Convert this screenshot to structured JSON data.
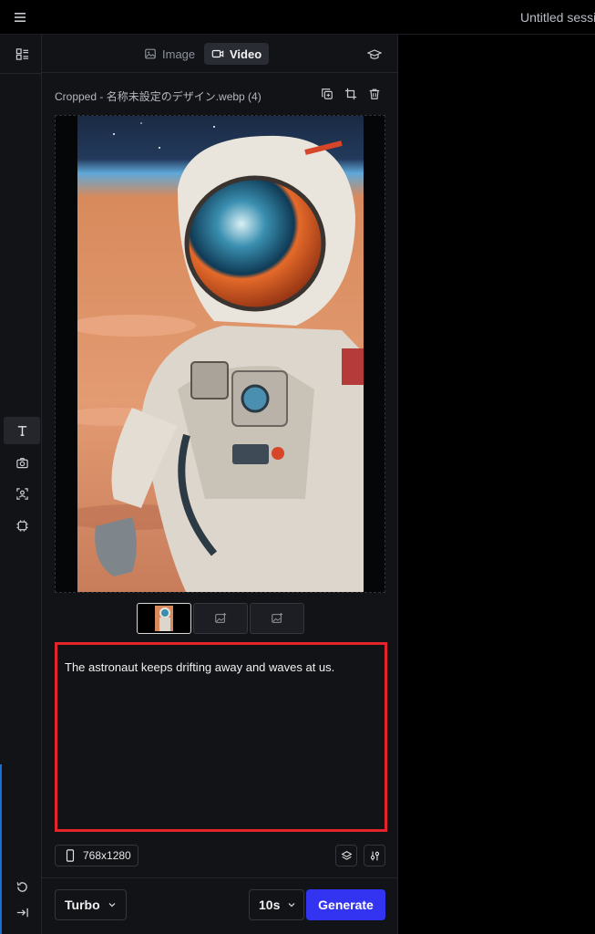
{
  "session": {
    "title": "Untitled session"
  },
  "modes": [
    {
      "label": "Image",
      "icon": "image-icon",
      "active": false
    },
    {
      "label": "Video",
      "icon": "video-camera-icon",
      "active": true
    }
  ],
  "file": {
    "title": "Cropped - 名称未設定のデザイン.webp (4)",
    "tools": [
      "duplicate-icon",
      "crop-icon",
      "trash-icon"
    ]
  },
  "thumbnails": [
    {
      "kind": "image",
      "active": true
    },
    {
      "kind": "placeholder",
      "icon": "add-image-icon",
      "active": false
    },
    {
      "kind": "placeholder",
      "icon": "add-image-icon",
      "active": false
    }
  ],
  "prompt": {
    "value": "The astronaut keeps drifting away and waves at us."
  },
  "resolution": {
    "label": "768x1280",
    "icon": "phone-portrait-icon"
  },
  "footer": {
    "model": "Turbo",
    "duration": "10s",
    "generate_label": "Generate"
  },
  "rail": [
    "text-icon",
    "camera-icon",
    "face-scan-icon",
    "frame-icon",
    "undo-icon",
    "collapse-icon"
  ],
  "colors": {
    "accent": "#3333f2",
    "highlight": "#e3242b",
    "panel": "#121317"
  }
}
